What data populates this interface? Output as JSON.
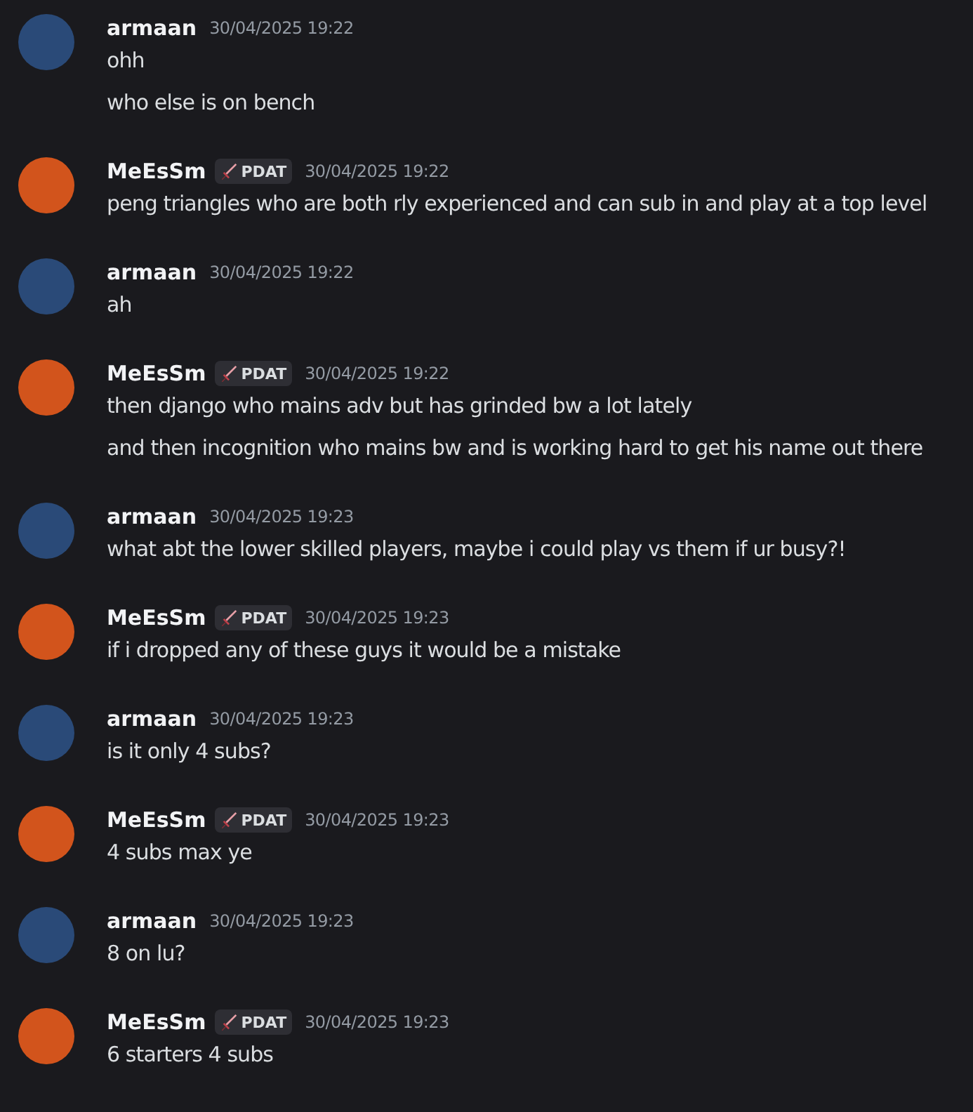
{
  "messages": [
    {
      "author": "armaan",
      "color": "#2a4a78",
      "timestamp": "30/04/2025 19:22",
      "lines": [
        "ohh",
        "who else is on bench"
      ]
    },
    {
      "author": "MeEsSm",
      "color": "#d2541c",
      "role_tag": "PDAT",
      "timestamp": "30/04/2025 19:22",
      "lines": [
        "peng triangles who are both rly experienced and can sub in and play at a top level"
      ]
    },
    {
      "author": "armaan",
      "color": "#2a4a78",
      "timestamp": "30/04/2025 19:22",
      "lines": [
        "ah"
      ]
    },
    {
      "author": "MeEsSm",
      "color": "#d2541c",
      "role_tag": "PDAT",
      "timestamp": "30/04/2025 19:22",
      "lines": [
        "then django who mains adv but has grinded bw a lot lately",
        "and then incognition who mains bw and is working hard to get his name out there"
      ]
    },
    {
      "author": "armaan",
      "color": "#2a4a78",
      "timestamp": "30/04/2025 19:23",
      "lines": [
        "what abt the lower skilled players, maybe i could play vs them if ur busy?!"
      ]
    },
    {
      "author": "MeEsSm",
      "color": "#d2541c",
      "role_tag": "PDAT",
      "timestamp": "30/04/2025 19:23",
      "lines": [
        "if i dropped any of these guys it would be a mistake"
      ]
    },
    {
      "author": "armaan",
      "color": "#2a4a78",
      "timestamp": "30/04/2025 19:23",
      "lines": [
        "is it only 4 subs?"
      ]
    },
    {
      "author": "MeEsSm",
      "color": "#d2541c",
      "role_tag": "PDAT",
      "timestamp": "30/04/2025 19:23",
      "lines": [
        "4 subs max ye"
      ]
    },
    {
      "author": "armaan",
      "color": "#2a4a78",
      "timestamp": "30/04/2025 19:23",
      "lines": [
        "8 on lu?"
      ]
    },
    {
      "author": "MeEsSm",
      "color": "#d2541c",
      "role_tag": "PDAT",
      "timestamp": "30/04/2025 19:23",
      "lines": [
        "6 starters 4 subs"
      ]
    }
  ]
}
